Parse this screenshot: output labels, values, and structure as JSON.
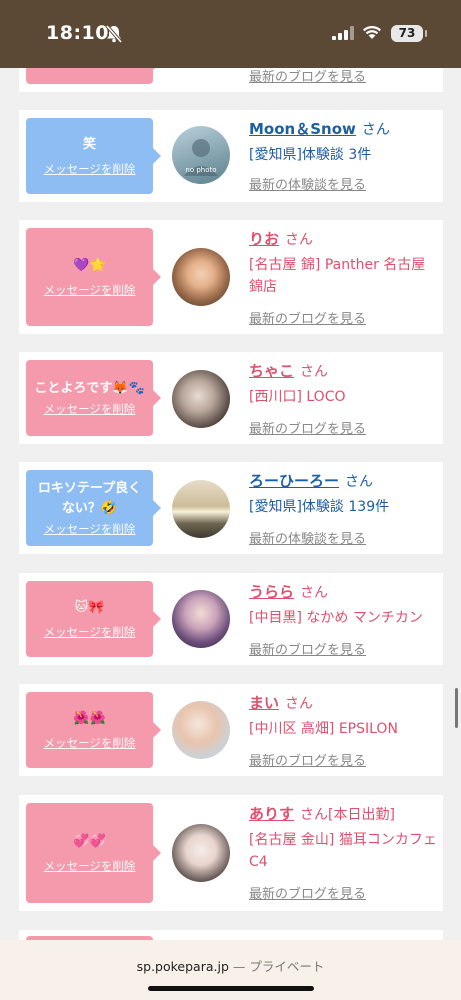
{
  "status": {
    "time": "18:10",
    "battery": "73"
  },
  "browser": {
    "url": "sp.pokepara.jp",
    "separator": " — ",
    "mode": "プライベート"
  },
  "top_partial": {
    "more": "最新のブログを見る"
  },
  "cards": [
    {
      "message": "笑",
      "delete": "メッセージを削除",
      "name": "Moon＆Snow",
      "san": "さん",
      "desc": "[愛知県]体験談 3件",
      "more": "最新の体験談を見る",
      "avatar_text": "no photo"
    },
    {
      "message": "💜🌟",
      "delete": "メッセージを削除",
      "name": "りお",
      "san": "さん",
      "desc": "[名古屋 錦] Panther 名古屋錦店",
      "more": "最新のブログを見る"
    },
    {
      "message": "ことよろです🦊🐾",
      "delete": "メッセージを削除",
      "name": "ちゃこ",
      "san": "さん",
      "desc": "[西川口] LOCO",
      "more": "最新のブログを見る"
    },
    {
      "message": "ロキソテープ良くない？🤣",
      "delete": "メッセージを削除",
      "name": "ろーひーろー",
      "san": "さん",
      "desc": "[愛知県]体験談 139件",
      "more": "最新の体験談を見る"
    },
    {
      "message": "🐱🎀",
      "delete": "メッセージを削除",
      "name": "うらら",
      "san": "さん",
      "desc": "[中目黒] なかめ マンチカン",
      "more": "最新のブログを見る"
    },
    {
      "message": "🌺🌺",
      "delete": "メッセージを削除",
      "name": "まい",
      "san": "さん",
      "desc": "[中川区 高畑] EPSILON",
      "more": "最新のブログを見る"
    },
    {
      "message": "💞💞",
      "delete": "メッセージを削除",
      "name": "ありす",
      "san": "さん[本日出勤]",
      "desc": "[名古屋 金山] 猫耳コンカフェ C4",
      "more": "最新のブログを見る"
    }
  ]
}
